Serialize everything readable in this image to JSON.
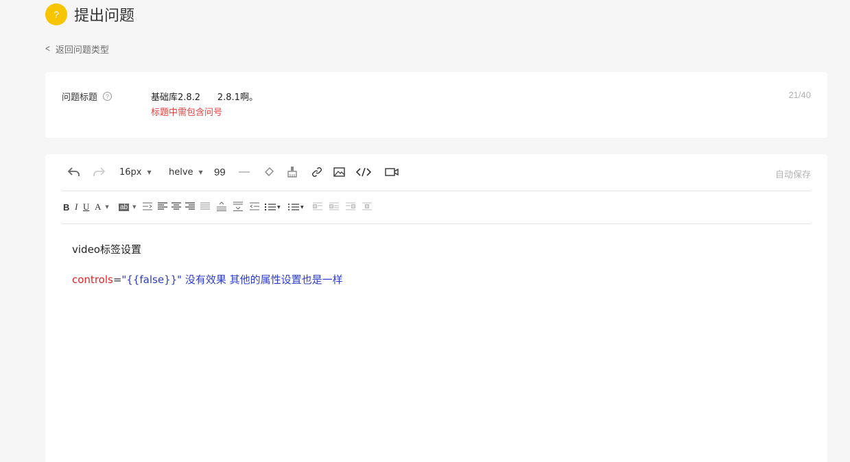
{
  "header": {
    "badge": "?",
    "title": "提出问题"
  },
  "back": {
    "label": "返回问题类型"
  },
  "title_field": {
    "label": "问题标题",
    "value": "基础库2.8.2      2.8.1啊。",
    "error": "标题中需包含问号",
    "count": "21/40"
  },
  "toolbar": {
    "font_size": "16px",
    "font_family": "helve",
    "quote_label": "99",
    "autosave": "自动保存"
  },
  "format_bar": {
    "bold": "B",
    "italic": "I",
    "underline": "U",
    "color": "A",
    "highlight": "ab"
  },
  "editor": {
    "line1": "video标签设置",
    "line2_attr": "controls",
    "line2_eq": "=",
    "line2_val": "\"{{false}}\"",
    "line2_rest": " 没有效果 其他的属性设置也是一样"
  },
  "colors": {
    "accent": "#f7c400",
    "error": "#e64340",
    "attr_red": "#e32525",
    "text_blue": "#2d3ccf"
  }
}
